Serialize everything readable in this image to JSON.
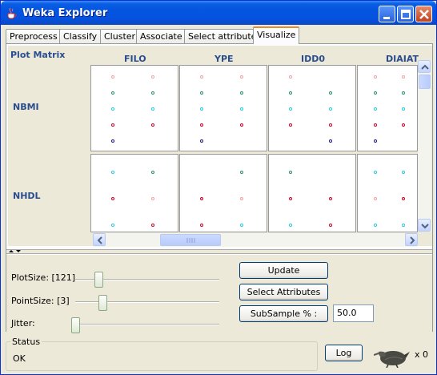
{
  "window": {
    "title": "Weka Explorer"
  },
  "tabs": [
    "Preprocess",
    "Classify",
    "Cluster",
    "Associate",
    "Select attributes",
    "Visualize"
  ],
  "active_tab": "Visualize",
  "plot_matrix": {
    "label": "Plot Matrix",
    "columns": [
      "FILO",
      "YPE",
      "IDD0",
      "DIAIAT"
    ],
    "rows": [
      "NBMI",
      "NHDL"
    ],
    "colors": {
      "pink": "#f2a0a0",
      "teal": "#2e8b6e",
      "cyan": "#22ccdd",
      "red": "#cc0022",
      "navy": "#1a1a88"
    }
  },
  "controls": {
    "plotsize_label": "PlotSize: [121]",
    "pointsize_label": "PointSize: [3]",
    "jitter_label": "Jitter:",
    "update_button": "Update",
    "select_attributes_button": "Select Attributes",
    "subsample_button": "SubSample % :",
    "subsample_value": "50.0"
  },
  "status": {
    "title": "Status",
    "text": "OK",
    "log_button": "Log",
    "task_count": "x 0"
  }
}
